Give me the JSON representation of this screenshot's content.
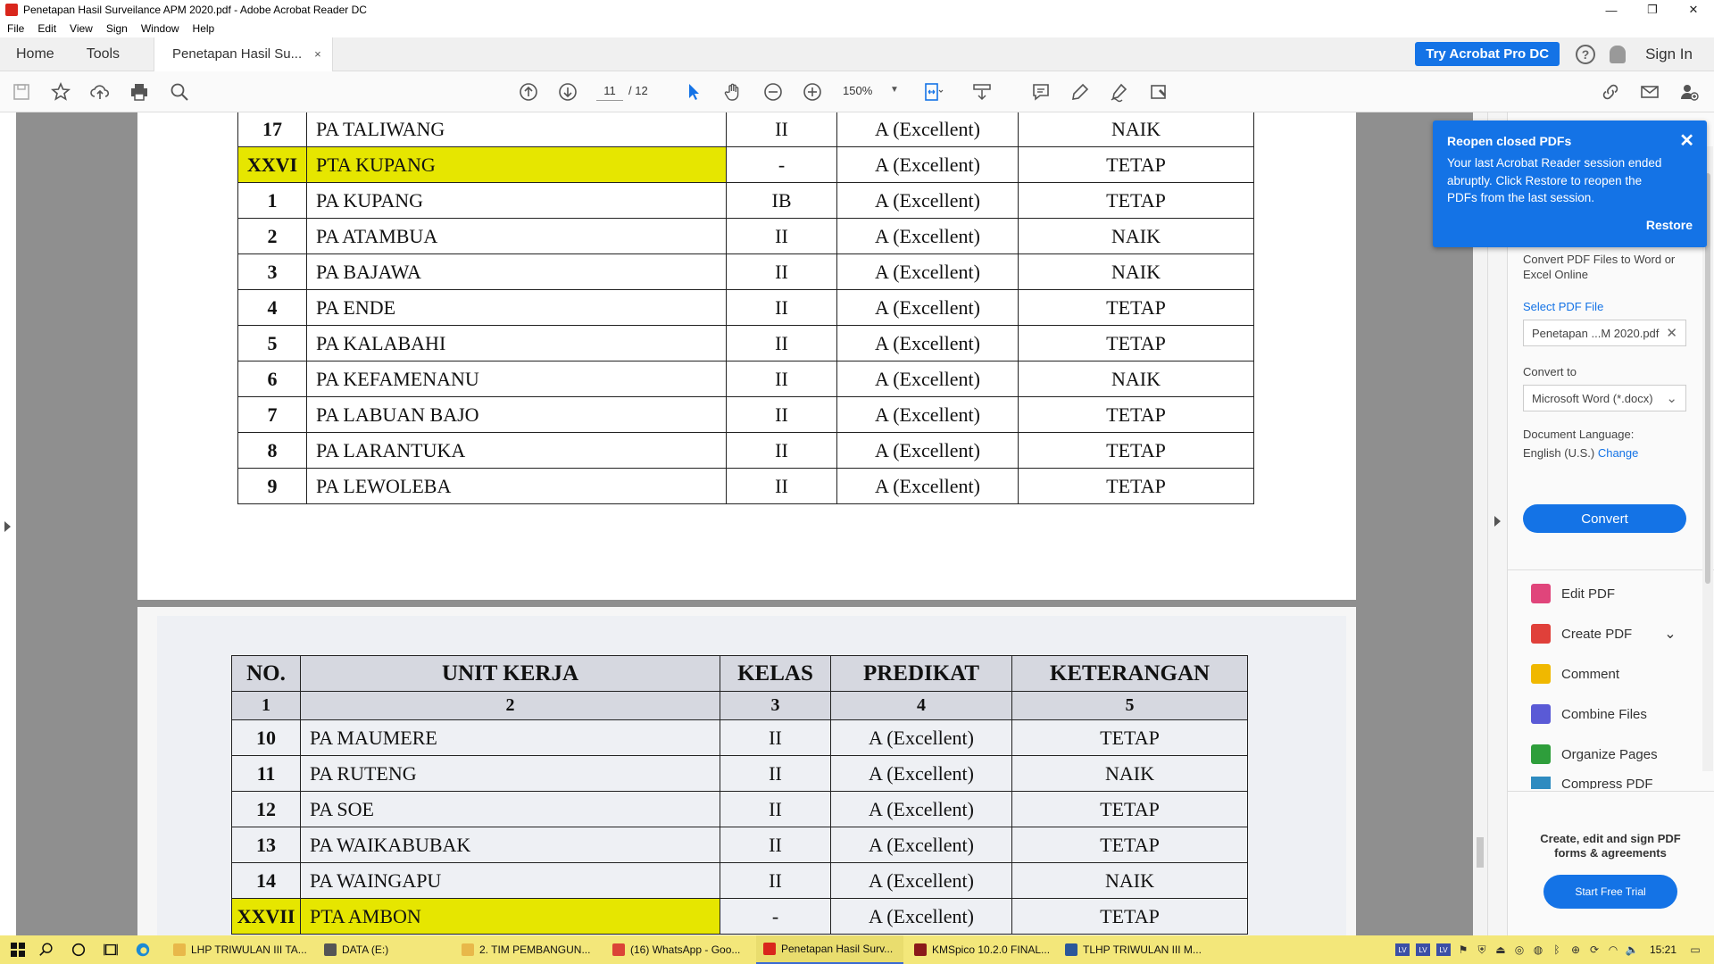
{
  "window": {
    "title": "Penetapan Hasil Surveilance APM 2020.pdf - Adobe Acrobat Reader DC",
    "minimize": "—",
    "maximize": "❐",
    "close": "✕"
  },
  "menu": [
    "File",
    "Edit",
    "View",
    "Sign",
    "Window",
    "Help"
  ],
  "tabs": {
    "home": "Home",
    "tools": "Tools",
    "document": "Penetapan Hasil Su...",
    "close": "×"
  },
  "header": {
    "try_button": "Try Acrobat Pro DC",
    "help": "?",
    "sign_in": "Sign In"
  },
  "toolbar": {
    "page_current": "11",
    "page_total": "/  12",
    "zoom": "150%"
  },
  "page1_rows": [
    {
      "no": "17",
      "unit": "PA TALIWANG",
      "kelas": "II",
      "predikat": "A (Excellent)",
      "ket": "NAIK",
      "highlight": false
    },
    {
      "no": "XXVI",
      "unit": "PTA KUPANG",
      "kelas": "-",
      "predikat": "A (Excellent)",
      "ket": "TETAP",
      "highlight": true
    },
    {
      "no": "1",
      "unit": "PA KUPANG",
      "kelas": "IB",
      "predikat": "A (Excellent)",
      "ket": "TETAP",
      "highlight": false
    },
    {
      "no": "2",
      "unit": "PA ATAMBUA",
      "kelas": "II",
      "predikat": "A (Excellent)",
      "ket": "NAIK",
      "highlight": false
    },
    {
      "no": "3",
      "unit": "PA BAJAWA",
      "kelas": "II",
      "predikat": "A (Excellent)",
      "ket": "NAIK",
      "highlight": false
    },
    {
      "no": "4",
      "unit": "PA ENDE",
      "kelas": "II",
      "predikat": "A (Excellent)",
      "ket": "TETAP",
      "highlight": false
    },
    {
      "no": "5",
      "unit": "PA KALABAHI",
      "kelas": "II",
      "predikat": "A (Excellent)",
      "ket": "TETAP",
      "highlight": false
    },
    {
      "no": "6",
      "unit": "PA KEFAMENANU",
      "kelas": "II",
      "predikat": "A (Excellent)",
      "ket": "NAIK",
      "highlight": false
    },
    {
      "no": "7",
      "unit": "PA LABUAN BAJO",
      "kelas": "II",
      "predikat": "A (Excellent)",
      "ket": "TETAP",
      "highlight": false
    },
    {
      "no": "8",
      "unit": "PA LARANTUKA",
      "kelas": "II",
      "predikat": "A (Excellent)",
      "ket": "TETAP",
      "highlight": false
    },
    {
      "no": "9",
      "unit": "PA LEWOLEBA",
      "kelas": "II",
      "predikat": "A (Excellent)",
      "ket": "TETAP",
      "highlight": false
    }
  ],
  "page2_header": {
    "cols": [
      "NO.",
      "UNIT KERJA",
      "KELAS",
      "PREDIKAT",
      "KETERANGAN"
    ],
    "nums": [
      "1",
      "2",
      "3",
      "4",
      "5"
    ]
  },
  "page2_rows": [
    {
      "no": "10",
      "unit": "PA MAUMERE",
      "kelas": "II",
      "predikat": "A (Excellent)",
      "ket": "TETAP",
      "highlight": false
    },
    {
      "no": "11",
      "unit": "PA RUTENG",
      "kelas": "II",
      "predikat": "A (Excellent)",
      "ket": "NAIK",
      "highlight": false
    },
    {
      "no": "12",
      "unit": "PA SOE",
      "kelas": "II",
      "predikat": "A (Excellent)",
      "ket": "TETAP",
      "highlight": false
    },
    {
      "no": "13",
      "unit": "PA WAIKABUBAK",
      "kelas": "II",
      "predikat": "A (Excellent)",
      "ket": "TETAP",
      "highlight": false
    },
    {
      "no": "14",
      "unit": "PA WAINGAPU",
      "kelas": "II",
      "predikat": "A (Excellent)",
      "ket": "NAIK",
      "highlight": false
    },
    {
      "no": "XXVII",
      "unit": "PTA AMBON",
      "kelas": "-",
      "predikat": "A (Excellent)",
      "ket": "TETAP",
      "highlight": true
    }
  ],
  "toast": {
    "title": "Reopen closed PDFs",
    "body": "Your last Acrobat Reader session ended abruptly. Click Restore to reopen the PDFs from the last session.",
    "close": "✕",
    "restore": "Restore"
  },
  "right_panel": {
    "convert_desc": "Convert PDF Files to Word or Excel Online",
    "select_file_label": "Select PDF File",
    "selected_file": "Penetapan ...M 2020.pdf",
    "file_clear": "✕",
    "convert_to_label": "Convert to",
    "convert_to_value": "Microsoft Word (*.docx)",
    "convert_to_caret": "⌄",
    "doc_language_label": "Document Language:",
    "doc_language_value": "English (U.S.)",
    "change_link": "Change",
    "convert_button": "Convert",
    "tools": [
      {
        "label": "Edit PDF",
        "color": "#e0457b"
      },
      {
        "label": "Create PDF",
        "color": "#e0403a"
      },
      {
        "label": "Comment",
        "color": "#f0b800"
      },
      {
        "label": "Combine Files",
        "color": "#5a5ad6"
      },
      {
        "label": "Organize Pages",
        "color": "#2e9e3b"
      },
      {
        "label": "Compress PDF",
        "color": "#2e8bc0"
      }
    ],
    "create_caret": "⌄",
    "promo_title": "Create, edit and sign PDF forms & agreements",
    "promo_button": "Start Free Trial"
  },
  "taskbar": {
    "items": [
      {
        "label": "LHP TRIWULAN III TA...",
        "color": "#e8b84a"
      },
      {
        "label": "DATA (E:)",
        "color": "#555555"
      },
      {
        "label": "2. TIM PEMBANGUN...",
        "color": "#e8b84a"
      },
      {
        "label": "(16) WhatsApp - Goo...",
        "color": "#db4437"
      },
      {
        "label": "Penetapan Hasil Surv...",
        "color": "#d9261c"
      },
      {
        "label": "KMSpico 10.2.0 FINAL...",
        "color": "#8b1a1a"
      },
      {
        "label": "TLHP TRIWULAN III M...",
        "color": "#2b579a"
      }
    ],
    "clock": "15:21"
  }
}
